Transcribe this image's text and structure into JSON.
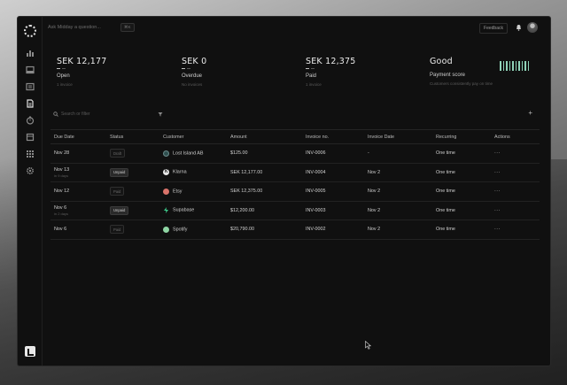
{
  "topbar": {
    "ask_placeholder": "Ask Midday a question...",
    "shortcut": "⌘K",
    "feedback_label": "Feedback"
  },
  "summary": [
    {
      "amount": "SEK 12,177",
      "label": "Open",
      "sub": "1 invoice"
    },
    {
      "amount": "SEK 0",
      "label": "Overdue",
      "sub": "No invoices"
    },
    {
      "amount": "SEK 12,375",
      "label": "Paid",
      "sub": "1 invoice"
    },
    {
      "amount": "Good",
      "label": "Payment score",
      "sub": "Customers consistently pay on time"
    }
  ],
  "search": {
    "placeholder": "Search or filter"
  },
  "table": {
    "headers": [
      "Due Date",
      "Status",
      "Customer",
      "Amount",
      "Invoice no.",
      "Invoice Date",
      "Recurring",
      "Actions"
    ],
    "rows": [
      {
        "due": "Nov 28",
        "due_sub": "",
        "status": "Draft",
        "status_type": "draft",
        "customer": "Lost Island AB",
        "customer_color": "#2f4f4f",
        "amount": "$125.00",
        "invoice_no": "INV-0006",
        "invoice_date": "-",
        "recurring": "One time",
        "actions": "···"
      },
      {
        "due": "Nov 13",
        "due_sub": "in 9 days",
        "status": "Unpaid",
        "status_type": "unpaid",
        "customer": "Klarna",
        "customer_color": "#e8e8e8",
        "amount": "SEK 12,177.00",
        "invoice_no": "INV-0004",
        "invoice_date": "Nov 2",
        "recurring": "One time",
        "actions": "···"
      },
      {
        "due": "Nov 12",
        "due_sub": "",
        "status": "Paid",
        "status_type": "paid",
        "customer": "Etsy",
        "customer_color": "#d9736a",
        "amount": "SEK 12,375.00",
        "invoice_no": "INV-0005",
        "invoice_date": "Nov 2",
        "recurring": "One time",
        "actions": "···"
      },
      {
        "due": "Nov 6",
        "due_sub": "in 2 days",
        "status": "Unpaid",
        "status_type": "unpaid",
        "customer": "Supabase",
        "customer_color": "#3ecf8e",
        "amount": "$12,200.00",
        "invoice_no": "INV-0003",
        "invoice_date": "Nov 2",
        "recurring": "One time",
        "actions": "···"
      },
      {
        "due": "Nov 6",
        "due_sub": "",
        "status": "Paid",
        "status_type": "paid",
        "customer": "Spotify",
        "customer_color": "#8fd6a4",
        "amount": "$20,790.00",
        "invoice_no": "INV-0002",
        "invoice_date": "Nov 2",
        "recurring": "One time",
        "actions": "···"
      }
    ]
  },
  "colors": {
    "score_bars": "#8fd2b8",
    "background": "#101010"
  }
}
